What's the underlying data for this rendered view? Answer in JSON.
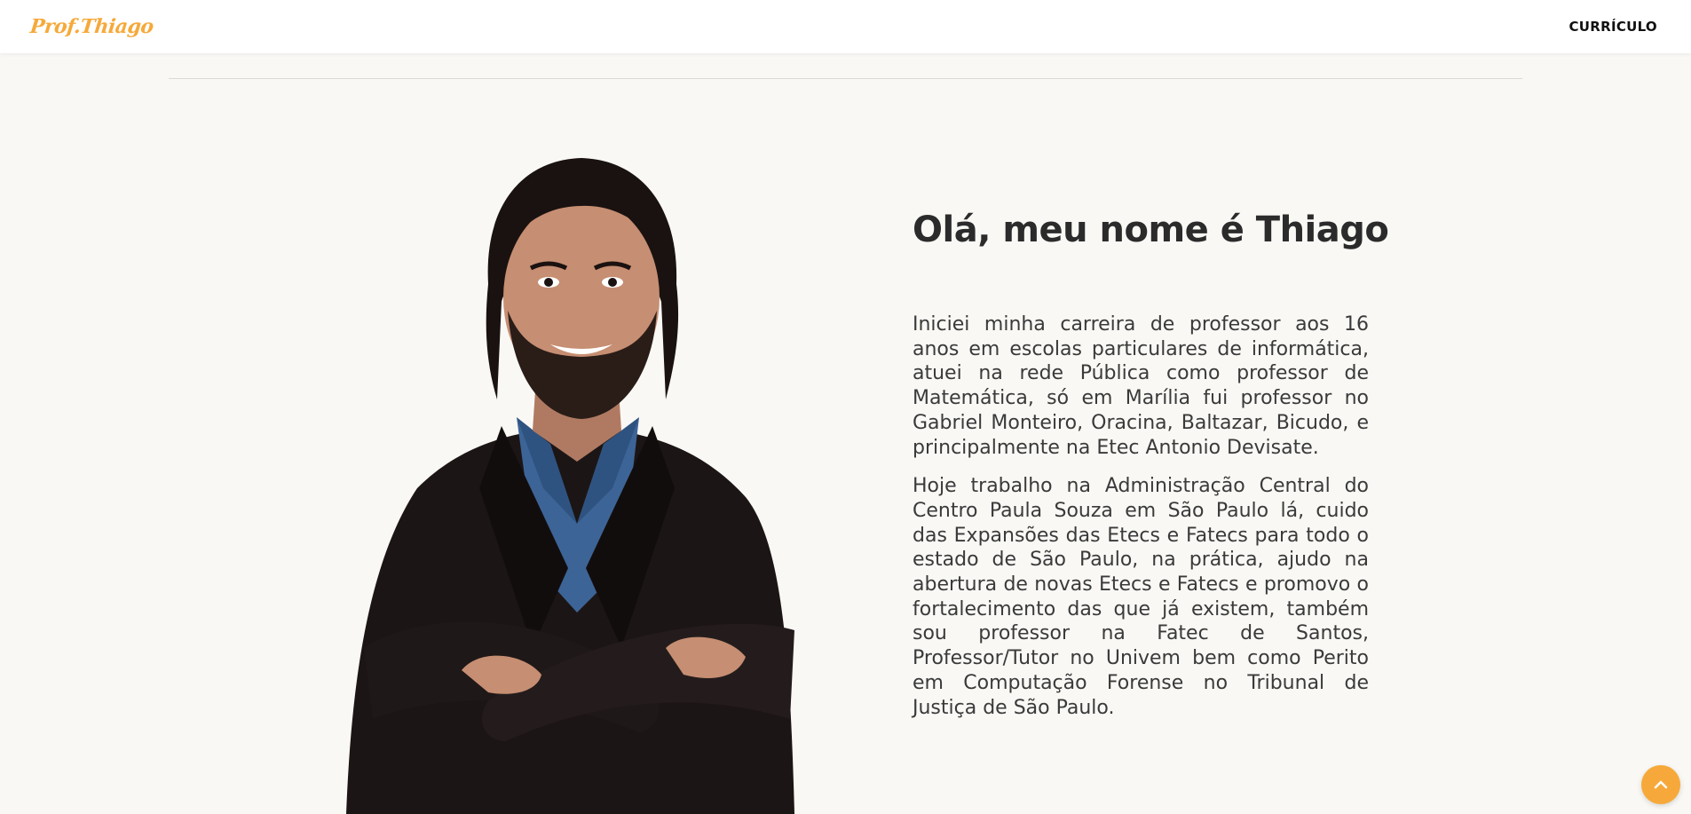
{
  "header": {
    "logo_text": "Prof.Thiago",
    "nav": [
      {
        "label": "CURRÍCULO"
      }
    ]
  },
  "about": {
    "heading": "Olá, meu nome é Thiago",
    "paragraphs": [
      "Iniciei minha carreira de professor aos 16 anos em escolas particulares de informática, atuei na rede Pública como professor de Matemática, só em Marília fui professor no Gabriel Monteiro, Oracina, Baltazar, Bicudo, e principalmente na Etec Antonio Devisate.",
      "Hoje trabalho na Administração Central do Centro Paula Souza em São Paulo lá, cuido das Expansões das Etecs e Fatecs para todo o estado de São Paulo, na prática, ajudo na abertura de novas Etecs e Fatecs e promovo o fortalecimento das que já existem, também sou professor na Fatec de Santos, Professor/Tutor no Univem bem como Perito em Computação Forense no Tribunal de Justiça de São Paulo."
    ]
  },
  "theme": {
    "accent": "#f6a93a",
    "background": "#f9f8f5"
  },
  "icons": {
    "scroll_top": "chevron-up-icon"
  }
}
